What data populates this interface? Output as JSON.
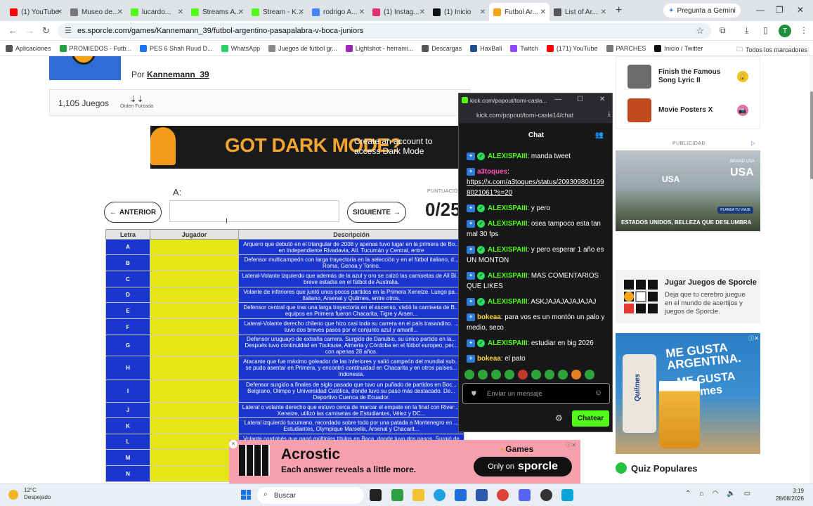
{
  "browser": {
    "tabs": [
      {
        "label": "(1) YouTube",
        "color": "#ff0000"
      },
      {
        "label": "Museo de...",
        "color": "#777777"
      },
      {
        "label": "lucardo...",
        "color": "#53fc18"
      },
      {
        "label": "Streams A...",
        "color": "#53fc18"
      },
      {
        "label": "Stream - K...",
        "color": "#53fc18"
      },
      {
        "label": "rodrigo A...",
        "color": "#4285f4"
      },
      {
        "label": "(1) Instag...",
        "color": "#e1306c"
      },
      {
        "label": "(1) Inicio",
        "color": "#111111"
      },
      {
        "label": "Futbol Ar...",
        "color": "#f4a41b"
      },
      {
        "label": "List of Ar...",
        "color": "#555555"
      }
    ],
    "gemini_label": "Pregunta a Gemini",
    "url": "es.sporcle.com/games/Kannemann_39/futbol-argentino-pasapalabra-v-boca-juniors",
    "profile_initial": "T",
    "bookmarks": [
      {
        "label": "Aplicaciones",
        "color": "#555555"
      },
      {
        "label": "PROMIEDOS - Futb...",
        "color": "#25a244"
      },
      {
        "label": "PES 6 Shah Ruud D...",
        "color": "#1877f2"
      },
      {
        "label": "WhatsApp",
        "color": "#25d366"
      },
      {
        "label": "Juegos de fútbol gr...",
        "color": "#888888"
      },
      {
        "label": "Lightshot - herrami...",
        "color": "#9c27b0"
      },
      {
        "label": "Descargas",
        "color": "#555555"
      },
      {
        "label": "HaxBall",
        "color": "#1f4f8c"
      },
      {
        "label": "Twitch",
        "color": "#9146ff"
      },
      {
        "label": "(171) YouTube",
        "color": "#ff0000"
      },
      {
        "label": "PARCHES",
        "color": "#777777"
      },
      {
        "label": "Inicio / Twitter",
        "color": "#111111"
      }
    ],
    "all_bookmarks": "Todos los marcadores"
  },
  "quiz": {
    "by_prefix": "Por",
    "author": "Kannemann_39",
    "plays": "1,105 Juegos",
    "forced_order": "Orden Forzada",
    "banner_title": "GOT DARK MODE?",
    "banner_sub_1": "Create an account to",
    "banner_sub_2": "access Dark Mode",
    "answer_label": "A:",
    "prev_label": "ANTERIOR",
    "next_label": "SIGUIENTE",
    "score_label": "PUNTUACIÓN",
    "score": "0/25",
    "table_headers": [
      "Letra",
      "Jugador",
      "Descripción"
    ],
    "rows": [
      {
        "letter": "A",
        "desc": "Arquero que debutó en el triangular de 2008 y apenas tuvo lugar en la primera de Bo... en Independiente Rivadavia, Atl. Tucumán y Central, entre"
      },
      {
        "letter": "B",
        "desc": "Defensor multicampeón con larga trayectoria en la selección y en el fútbol italiano, d... Roma, Genoa y Torino."
      },
      {
        "letter": "C",
        "desc": "Lateral-Volante izquierdo que además de la azul y oro se calzó las camisetas de All Bl... breve estadía en el fútbol de Australia."
      },
      {
        "letter": "D",
        "desc": "Volante de inferiores que juntó unos pocos partidos en la Primera Xeneize. Luego pa... Italiano, Arsenal y Quilmes, entre otros."
      },
      {
        "letter": "E",
        "desc": "Defensor central que tras una larga trayectoria en el ascenso, vistió la camiseta de B... equipos en Primera fueron Chacarita, Tigre y Arsen..."
      },
      {
        "letter": "F",
        "desc": "Lateral-Volante derecho chileno que hizo casi toda su carrera en el país trasandino. ... tuvo dos breves pasos por el conjunto azul y amarill..."
      },
      {
        "letter": "G",
        "desc": "Defensor uruguayo de extraña carrera. Surgido de Danubio, su único partido en la... Después tuvo continuidad en Toulouse, Almería y Córdoba en el fútbol europeo, per... con apenas 28 años."
      },
      {
        "letter": "H",
        "desc": "Atacante que fue máximo goleador de las inferiores y salió campeón del mundial sub... se pudo asentar en Primera, y encontró continuidad en Chacarita y en otros países... Indonesia."
      },
      {
        "letter": "I",
        "desc": "Defensor surgido a finales de siglo pasado que tuvo un puñado de partidos en Boc... Belgrano, Olimpo y Universidad Católica, donde tuvo su paso más destacado. De... Deportivo Cuenca de Ecuador."
      },
      {
        "letter": "J",
        "desc": "Lateral o volante derecho que estuvo cerca de marcar el empate en la final con River ... Xeneize, utilizó las camisetas de Estudiantes, Vélez y DC..."
      },
      {
        "letter": "K",
        "desc": "Lateral izquierdo tucumano, recordado sobre todo por una patada a Montenegro en ... Estudiantes, Olympique Marsella, Arsenal y Chacarit..."
      },
      {
        "letter": "L",
        "desc": "Volante cordobés que ganó múltiples títulos en Boca, donde tuvo dos pasos. Surgió de Talleres, y además vistió las..."
      },
      {
        "letter": "M",
        "desc": ""
      },
      {
        "letter": "N",
        "desc": ""
      }
    ]
  },
  "sidebar": {
    "related": [
      {
        "title": "Finish the Famous Song Lyric II",
        "badge": "🔒",
        "thumb": "#6b6b6b"
      },
      {
        "title": "Movie Posters X",
        "badge": "📷",
        "thumb": "#c2481d"
      }
    ],
    "ad_label": "PUBLICIDAD",
    "usa_ad_title": "USA",
    "usa_ad_brand": "BRAND USA",
    "usa_ad_caption": "ESTADOS UNIDOS, BELLEZA QUE DESLUMBRA",
    "usa_ad_button": "PLANEA TU VIAJE",
    "jugar_title": "Jugar Juegos de Sporcle",
    "jugar_text": "Deja que tu cerebro juegue en el mundo de acertijos y juegos de Sporcle.",
    "beer_line_1": "ME GUSTA ARGENTINA.",
    "beer_line_2": "ME GUSTA Quilmes",
    "beer_brand": "Quilmes",
    "popular_label": "Quiz Populares"
  },
  "acrostic_ad": {
    "title": "Acrostic",
    "subtitle": "Each answer reveals a little more.",
    "games_label": "Games",
    "only_on": "Only on",
    "brand": "sporcle"
  },
  "kick_popout": {
    "window_title": "kick.com/popout/tomi-casla...",
    "url": "kick.com/popout/tomi-casla14/chat",
    "chat_title": "Chat",
    "messages": [
      {
        "user": "ALEXISPAIII",
        "color": "#53fc18",
        "text": ": manda tweet",
        "badges": true
      },
      {
        "user": "a3toques",
        "color": "#ff4fb8",
        "text": ":",
        "badges": false,
        "link": "https://x.com/a3toques/status/2093098041998021061?s=20"
      },
      {
        "user": "ALEXISPAIII",
        "color": "#53fc18",
        "text": ": y pero",
        "badges": true
      },
      {
        "user": "ALEXISPAIII",
        "color": "#53fc18",
        "text": ": osea tampoco esta tan mal 30 fps",
        "badges": true
      },
      {
        "user": "ALEXISPAIII",
        "color": "#53fc18",
        "text": ": y pero esperar 1 año es UN MONTON",
        "badges": true
      },
      {
        "user": "ALEXISPAIII",
        "color": "#53fc18",
        "text": ": MAS COMENTARIOS QUE LIKES",
        "badges": true
      },
      {
        "user": "ALEXISPAIII",
        "color": "#53fc18",
        "text": ": ASKJAJAJAJAJAJAJ",
        "badges": true
      },
      {
        "user": "bokeaa",
        "color": "#f5d33b",
        "text": ": para vos es un montón un palo y medio, seco",
        "badges": false
      },
      {
        "user": "ALEXISPAIII",
        "color": "#53fc18",
        "text": ": estudiar en big 2026",
        "badges": true
      },
      {
        "user": "bokeaa",
        "color": "#f5d33b",
        "text": ": el pato",
        "badges": false
      }
    ],
    "input_placeholder": "Enviar un mensaje",
    "send_label": "Chatear"
  },
  "taskbar": {
    "temp": "12°C",
    "weather": "Despejado",
    "search_placeholder": "Buscar",
    "time": "3:19",
    "date": "28/08/2026"
  }
}
